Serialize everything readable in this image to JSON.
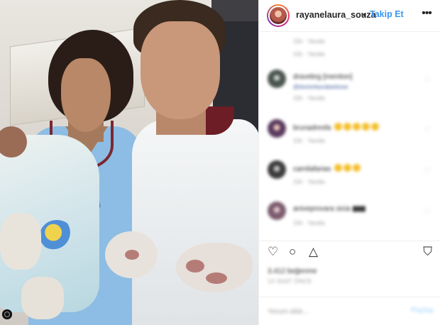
{
  "header": {
    "username": "rayanelaura_souza",
    "separator": "•",
    "follow_label": "Takip Et",
    "more_icon": "more-horizontal-icon"
  },
  "comments": [
    {
      "meta": "15h · Yanıtla"
    },
    {
      "text": "dravebrg [mention]",
      "sub": "@doctorlaurabarbosa",
      "meta": "15h · Yanıtla"
    },
    {
      "text": "brunadresfa",
      "emoji_count": 5,
      "meta": "15h · Yanıtla"
    },
    {
      "text": "camilafarias",
      "emoji_count": 3,
      "meta": "15h · Yanıtla"
    },
    {
      "text": "aniveprovara sicia",
      "meta": "15h · Yanıtla"
    }
  ],
  "actions": {
    "like_icon": "heart-outline-icon",
    "comment_icon": "comment-bubble-icon",
    "share_icon": "share-icon",
    "save_icon": "bookmark-icon"
  },
  "likes_text": "3.412 beğenme",
  "timestamp": "14 SAAT ÖNCE",
  "add_comment": {
    "placeholder": "Yorum ekle...",
    "post_label": "Paylaş"
  },
  "colors": {
    "accent": "#3897f0",
    "text": "#262626",
    "muted": "#999999",
    "border": "#efefef"
  }
}
